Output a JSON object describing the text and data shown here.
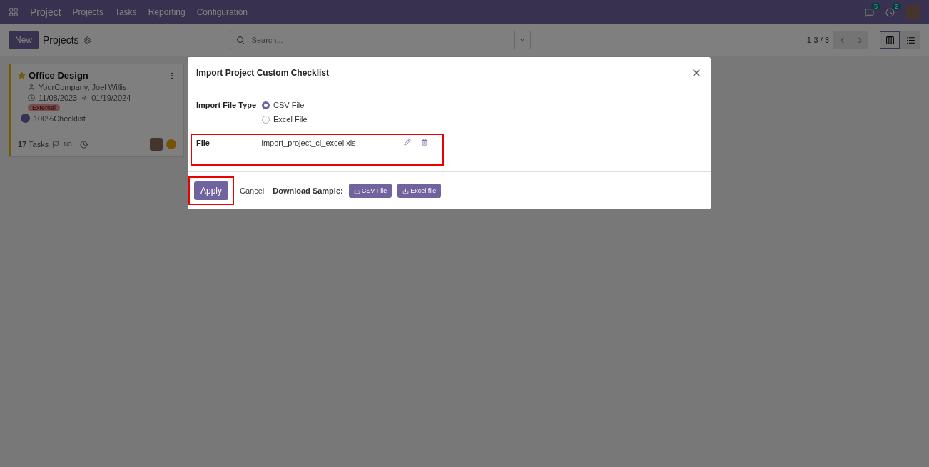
{
  "navbar": {
    "app_name": "Project",
    "menu": [
      "Projects",
      "Tasks",
      "Reporting",
      "Configuration"
    ],
    "message_count": "5",
    "activity_count": "2"
  },
  "control_panel": {
    "new_button": "New",
    "title": "Projects",
    "search": {
      "placeholder": "Search..."
    },
    "pager": "1-3 / 3",
    "views": [
      {
        "kind": "kanban",
        "selected": true
      },
      {
        "kind": "list",
        "selected": false
      }
    ]
  },
  "card": {
    "title": "Office Design",
    "starred": true,
    "customer": "YourCompany, Joel Willis",
    "date_start": "11/08/2023",
    "date_end": "01/19/2024",
    "tag": "External",
    "checklist": {
      "label": "100%Checklist",
      "level": 1
    },
    "tasks_count": "17",
    "tasks_label": "Tasks",
    "milestones": "1/3"
  },
  "dialog": {
    "title": "Import Project Custom Checklist",
    "file_type_label": "Import File Type",
    "options": [
      {
        "label": "CSV File",
        "selected": true
      },
      {
        "label": "Excel File",
        "selected": false
      }
    ],
    "file_label": "File",
    "file_name": "import_project_cl_excel.xls",
    "apply": "Apply",
    "cancel": "Cancel",
    "download_label": "Download Sample:",
    "samples": [
      "CSV File",
      "Excel file"
    ]
  }
}
